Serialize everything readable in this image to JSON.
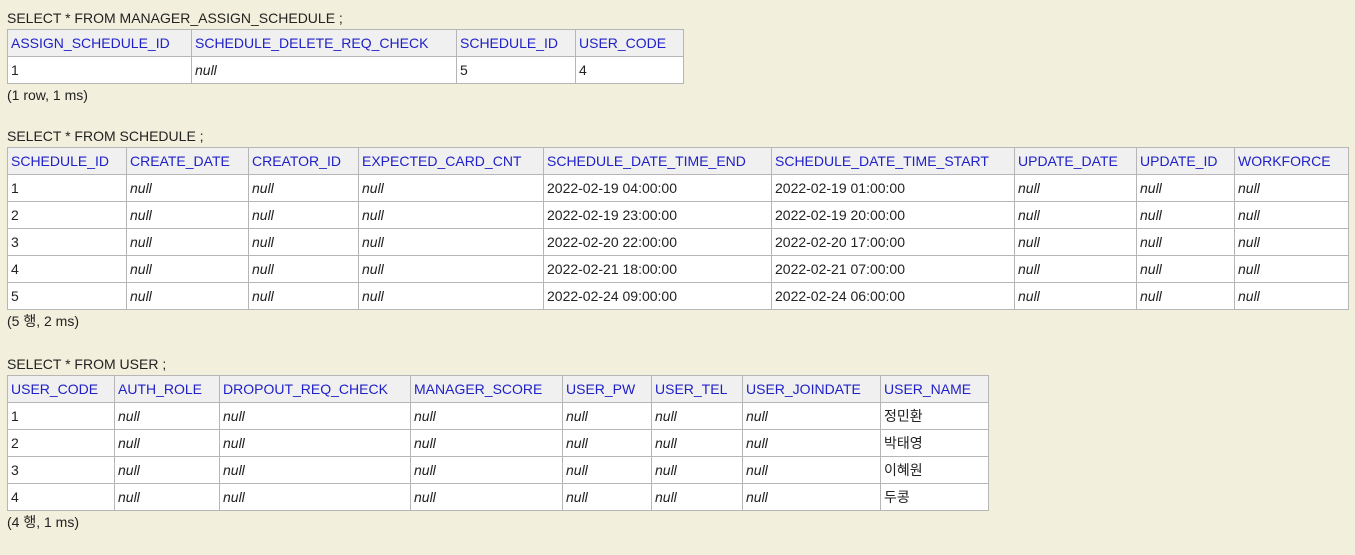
{
  "results": [
    {
      "query": "SELECT * FROM MANAGER_ASSIGN_SCHEDULE ;",
      "columns": [
        "ASSIGN_SCHEDULE_ID",
        "SCHEDULE_DELETE_REQ_CHECK",
        "SCHEDULE_ID",
        "USER_CODE"
      ],
      "rows": [
        [
          "1",
          "null",
          "5",
          "4"
        ]
      ],
      "status": "(1 row, 1 ms)"
    },
    {
      "query": "SELECT * FROM SCHEDULE ;",
      "columns": [
        "SCHEDULE_ID",
        "CREATE_DATE",
        "CREATOR_ID",
        "EXPECTED_CARD_CNT",
        "SCHEDULE_DATE_TIME_END",
        "SCHEDULE_DATE_TIME_START",
        "UPDATE_DATE",
        "UPDATE_ID",
        "WORKFORCE"
      ],
      "rows": [
        [
          "1",
          "null",
          "null",
          "null",
          "2022-02-19 04:00:00",
          "2022-02-19 01:00:00",
          "null",
          "null",
          "null"
        ],
        [
          "2",
          "null",
          "null",
          "null",
          "2022-02-19 23:00:00",
          "2022-02-19 20:00:00",
          "null",
          "null",
          "null"
        ],
        [
          "3",
          "null",
          "null",
          "null",
          "2022-02-20 22:00:00",
          "2022-02-20 17:00:00",
          "null",
          "null",
          "null"
        ],
        [
          "4",
          "null",
          "null",
          "null",
          "2022-02-21 18:00:00",
          "2022-02-21 07:00:00",
          "null",
          "null",
          "null"
        ],
        [
          "5",
          "null",
          "null",
          "null",
          "2022-02-24 09:00:00",
          "2022-02-24 06:00:00",
          "null",
          "null",
          "null"
        ]
      ],
      "status": "(5 행, 2 ms)"
    },
    {
      "query": "SELECT * FROM USER ;",
      "columns": [
        "USER_CODE",
        "AUTH_ROLE",
        "DROPOUT_REQ_CHECK",
        "MANAGER_SCORE",
        "USER_PW",
        "USER_TEL",
        "USER_JOINDATE",
        "USER_NAME"
      ],
      "rows": [
        [
          "1",
          "null",
          "null",
          "null",
          "null",
          "null",
          "null",
          "정민환"
        ],
        [
          "2",
          "null",
          "null",
          "null",
          "null",
          "null",
          "null",
          "박태영"
        ],
        [
          "3",
          "null",
          "null",
          "null",
          "null",
          "null",
          "null",
          "이혜원"
        ],
        [
          "4",
          "null",
          "null",
          "null",
          "null",
          "null",
          "null",
          "두콩"
        ]
      ],
      "status": "(4 행, 1 ms)"
    }
  ]
}
